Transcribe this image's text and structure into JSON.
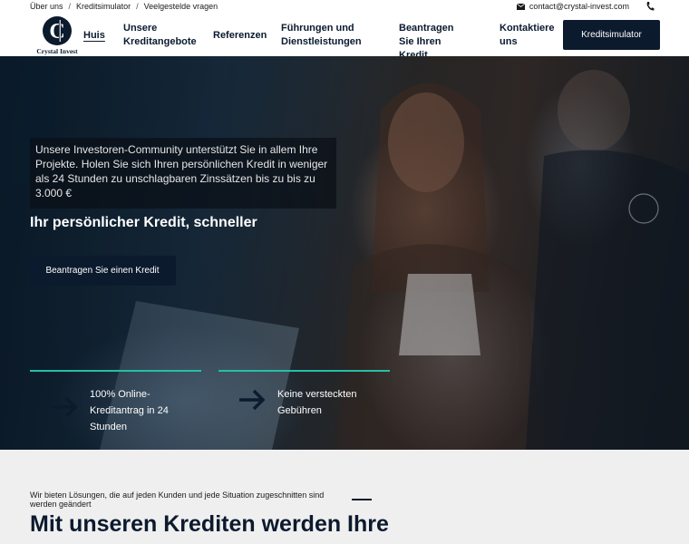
{
  "topbar": {
    "links": [
      "Über uns",
      "Kreditsimulator",
      "Veelgestelde vragen"
    ],
    "email": "contact@crystal-invest.com"
  },
  "brand": {
    "name": "Crystal Invest",
    "logo_letter": "C"
  },
  "nav": {
    "items": [
      {
        "label": "Huis"
      },
      {
        "label": "Unsere Kreditangebote"
      },
      {
        "label": "Referenzen"
      },
      {
        "label": "Führungen und Dienstleistungen"
      },
      {
        "label": "Beantragen Sie Ihren Kredit"
      },
      {
        "label": "Kontaktiere uns"
      }
    ],
    "cta": "Kreditsimulator"
  },
  "hero": {
    "intro": "Unsere Investoren-Community unterstützt Sie in allem Ihre Projekte. Holen Sie sich Ihren persönlichen Kredit in weniger als 24 Stunden zu unschlagbaren Zinssätzen bis zu bis zu 3.000 €",
    "title": "Ihr persönlicher Kredit, schneller",
    "button": "Beantragen Sie einen Kredit",
    "features": [
      {
        "text": "100% Online-Kreditantrag in 24 Stunden"
      },
      {
        "text": "Keine versteckten Gebühren"
      }
    ]
  },
  "section": {
    "subtitle": "Wir bieten Lösungen, die auf jeden Kunden und jede Situation zugeschnitten sind werden geändert",
    "title": "Mit unseren Krediten werden Ihre"
  },
  "colors": {
    "navy": "#0c1a2e",
    "accent": "#25c0a6"
  }
}
